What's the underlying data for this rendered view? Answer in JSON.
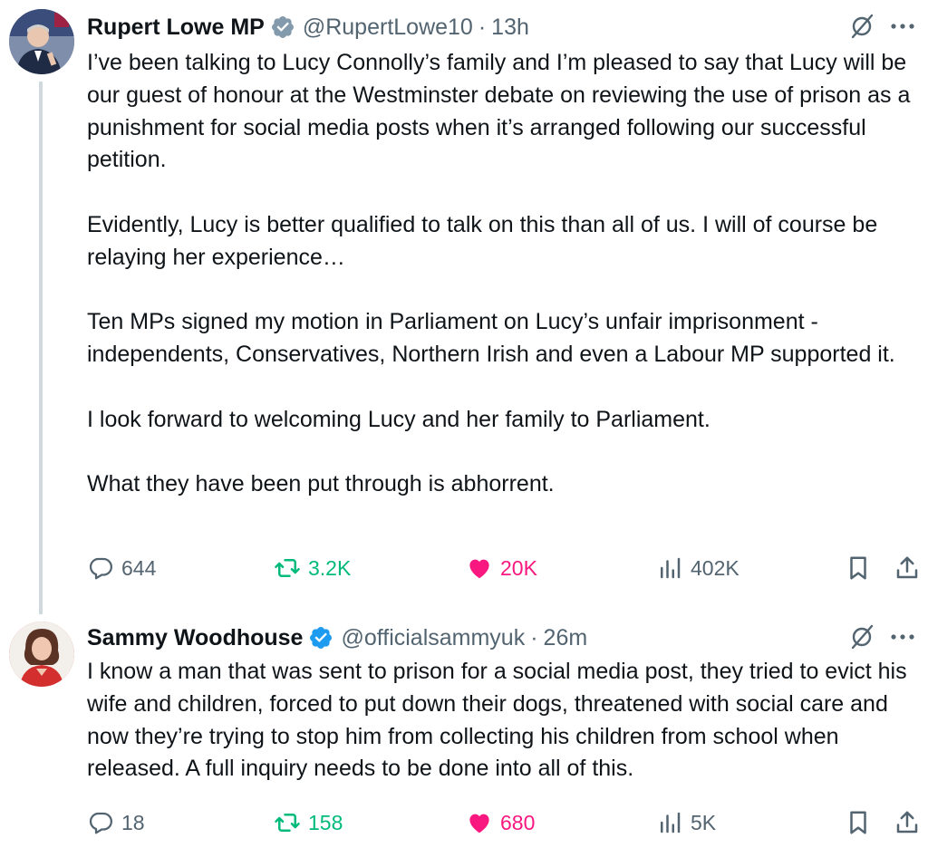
{
  "tweets": [
    {
      "author": {
        "name": "Rupert Lowe MP",
        "handle": "@RupertLowe10",
        "separator": "·",
        "time": "13h",
        "verified_color": "#829aab"
      },
      "paragraphs": [
        "I’ve been talking to Lucy Connolly’s family and I’m pleased to say that Lucy will be our guest of honour at the Westminster debate on reviewing the use of prison as a punishment for social media posts when it’s arranged following our successful petition.",
        "Evidently, Lucy is better qualified to talk on this than all of us. I will of course be relaying her experience…",
        "Ten MPs signed my motion in Parliament on Lucy’s unfair imprisonment - independents, Conservatives, Northern Irish and even a Labour MP supported it.",
        "I look forward to welcoming Lucy and her family to Parliament.",
        "What they have been put through is abhorrent."
      ],
      "stats": {
        "replies": "644",
        "reposts": "3.2K",
        "likes": "20K",
        "views": "402K"
      }
    },
    {
      "author": {
        "name": "Sammy Woodhouse",
        "handle": "@officialsammyuk",
        "separator": "·",
        "time": "26m",
        "verified_color": "#1d9bf0"
      },
      "paragraphs": [
        "I know a man that was sent to prison for a social media post, they tried to evict his wife and children, forced to put down their dogs, threatened with social care and now they’re trying to stop him from collecting his children from school when released. A full inquiry needs to be done into all of this."
      ],
      "stats": {
        "replies": "18",
        "reposts": "158",
        "likes": "680",
        "views": "5K"
      }
    }
  ],
  "icons": {
    "reply": "reply-icon",
    "repost": "repost-icon",
    "like": "heart-icon",
    "views": "views-icon",
    "bookmark": "bookmark-icon",
    "share": "share-icon",
    "grok": "grok-icon",
    "more": "more-icon"
  },
  "colors": {
    "text": "#0f1419",
    "muted": "#536471",
    "repost": "#00ba7c",
    "like": "#f91880",
    "thread_line": "#cfd9de"
  }
}
